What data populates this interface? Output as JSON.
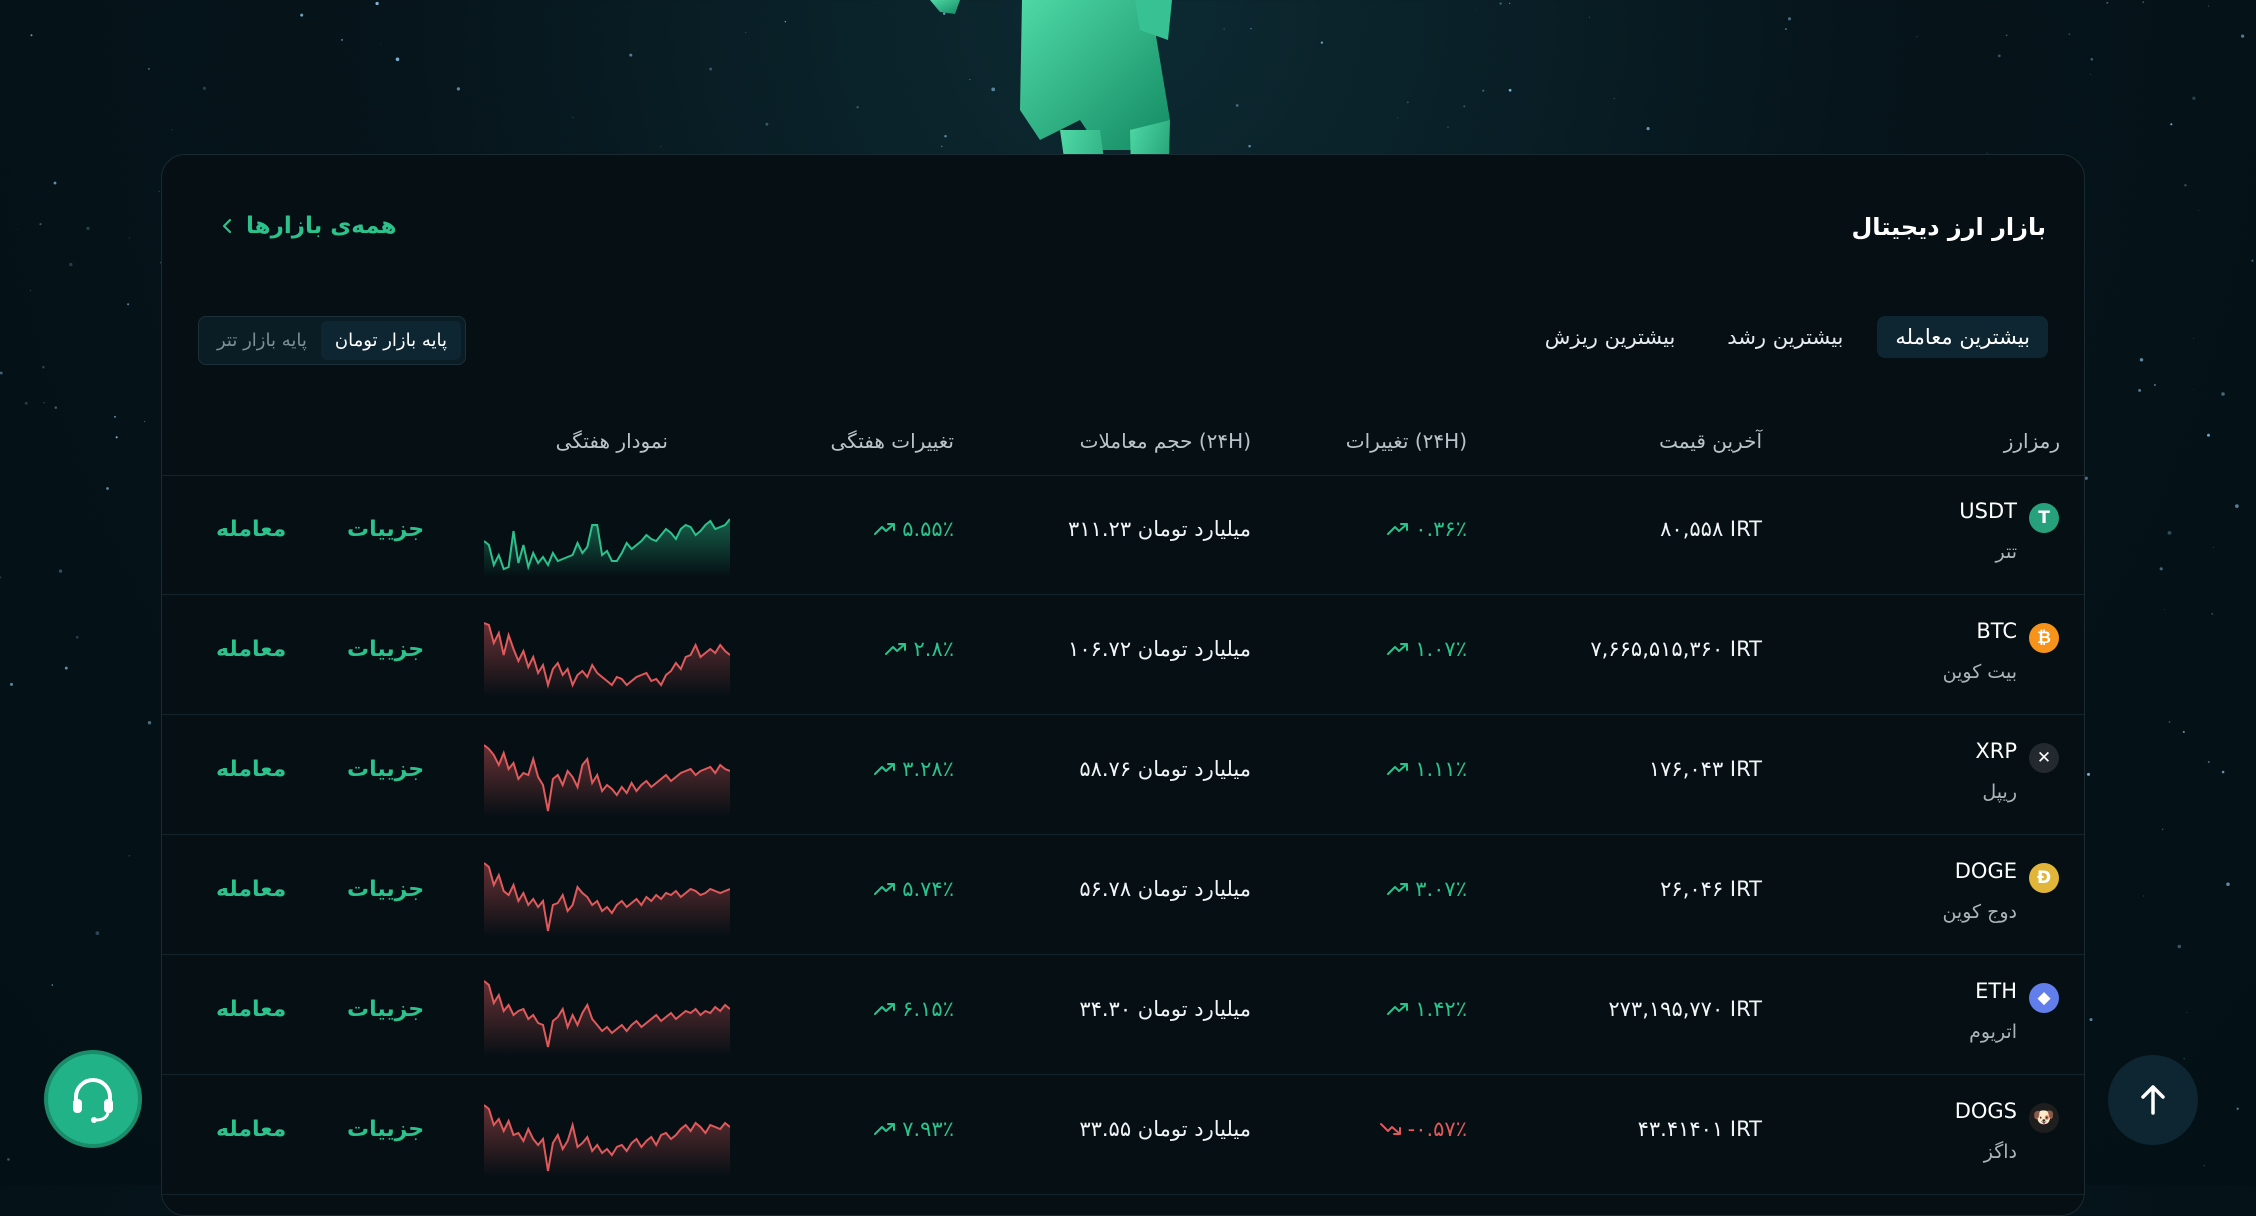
{
  "market": {
    "title": "بازار ارز دیجیتال",
    "all_markets_label": "همه‌ی بازارها",
    "tabs": [
      "بیشترین معامله",
      "بیشترین رشد",
      "بیشترین ریزش"
    ],
    "base_options": [
      "پایه بازار تومان",
      "پایه بازار تتر"
    ],
    "headers": {
      "symbol": "رمزارز",
      "price": "آخرین قیمت",
      "change_24h": "تغییرات (۲۴H)",
      "volume_24h": "حجم معاملات (۲۴H)",
      "change_7d": "تغییرات هفتگی",
      "chart_7d": "نمودار هفتگی"
    },
    "rows": [
      {
        "symbol": "USDT",
        "name": "تتر",
        "price": "۸۰,۵۵۸ IRT",
        "change_24h": "۰.۳۶٪",
        "change_24h_dir": "up",
        "volume": "۳۱۱.۲۳ میلیارد تومان",
        "change_7d": "۵.۵۵٪",
        "change_7d_dir": "up",
        "spark_color": "#2cc28c",
        "details": "جزییات",
        "trade": "معامله",
        "icon": "tether-icon",
        "icon_color": "#26a17b",
        "icon_glyph": "T"
      },
      {
        "symbol": "BTC",
        "name": "بیت کوین",
        "price": "۷,۶۶۵,۵۱۵,۳۶۰ IRT",
        "change_24h": "۱.۰۷٪",
        "change_24h_dir": "up",
        "volume": "۱۰۶.۷۲ میلیارد تومان",
        "change_7d": "۲.۸٪",
        "change_7d_dir": "up",
        "spark_color": "#e0595b",
        "details": "جزییات",
        "trade": "معامله",
        "icon": "bitcoin-icon",
        "icon_color": "#f7931a",
        "icon_glyph": "₿"
      },
      {
        "symbol": "XRP",
        "name": "ریپل",
        "price": "۱۷۶,۰۴۳ IRT",
        "change_24h": "۱.۱۱٪",
        "change_24h_dir": "up",
        "volume": "۵۸.۷۶ میلیارد تومان",
        "change_7d": "۳.۲۸٪",
        "change_7d_dir": "up",
        "spark_color": "#e0595b",
        "details": "جزییات",
        "trade": "معامله",
        "icon": "xrp-icon",
        "icon_color": "#23292f",
        "icon_glyph": "✕"
      },
      {
        "symbol": "DOGE",
        "name": "دوج کوین",
        "price": "۲۶,۰۴۶ IRT",
        "change_24h": "۳.۰۷٪",
        "change_24h_dir": "up",
        "volume": "۵۶.۷۸ میلیارد تومان",
        "change_7d": "۵.۷۴٪",
        "change_7d_dir": "up",
        "spark_color": "#e0595b",
        "details": "جزییات",
        "trade": "معامله",
        "icon": "dogecoin-icon",
        "icon_color": "#e0b53a",
        "icon_glyph": "Ð"
      },
      {
        "symbol": "ETH",
        "name": "اتریوم",
        "price": "۲۷۳,۱۹۵,۷۷۰ IRT",
        "change_24h": "۱.۴۲٪",
        "change_24h_dir": "up",
        "volume": "۳۴.۳۰ میلیارد تومان",
        "change_7d": "۶.۱۵٪",
        "change_7d_dir": "up",
        "spark_color": "#e0595b",
        "details": "جزییات",
        "trade": "معامله",
        "icon": "ethereum-icon",
        "icon_color": "#627eea",
        "icon_glyph": "◆"
      },
      {
        "symbol": "DOGS",
        "name": "داگز",
        "price": "۴۳.۴۱۴۰۱ IRT",
        "change_24h": "-۰.۵۷٪",
        "change_24h_dir": "down",
        "volume": "۳۳.۵۵ میلیارد تومان",
        "change_7d": "۷.۹۳٪",
        "change_7d_dir": "up",
        "spark_color": "#e0595b",
        "details": "جزییات",
        "trade": "معامله",
        "icon": "dogs-icon",
        "icon_color": "#1e1e1e",
        "icon_glyph": "🐶"
      }
    ]
  },
  "colors": {
    "accent": "#2cc28c",
    "negative": "#e0595b",
    "background": "#031016"
  }
}
